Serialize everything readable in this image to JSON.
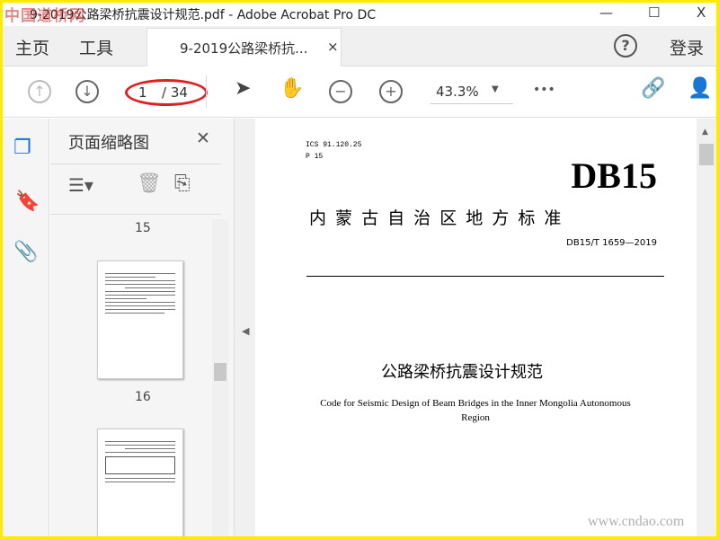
{
  "window": {
    "title": "9-2019公路梁桥抗震设计规范.pdf - Adobe Acrobat Pro DC",
    "watermark_top": "中国道桥网",
    "watermark_bottom": "www.cndao.com",
    "minimize": "—",
    "maximize": "☐",
    "close": "X"
  },
  "tabs": {
    "home": "主页",
    "tools": "工具",
    "document": "9-2019公路梁桥抗...",
    "close": "×",
    "help": "?",
    "login": "登录"
  },
  "toolbar": {
    "page_current": "1",
    "page_total": "/ 34",
    "zoom": "43.3%",
    "more": "•••"
  },
  "panel": {
    "title": "页面缩略图",
    "close": "✕",
    "thumbnails": [
      {
        "label": "15"
      },
      {
        "label": "16"
      }
    ]
  },
  "document": {
    "ics": "ICS 91.120.25",
    "p": "P 15",
    "code": "DB15",
    "org": "内 蒙 古 自 治 区 地 方 标 准",
    "std_no": "DB15/T 1659—2019",
    "title_cn": "公路梁桥抗震设计规范",
    "title_en": "Code for Seismic Design of Beam Bridges in the Inner Mongolia Autonomous Region"
  },
  "colors": {
    "accent": "#1473e6",
    "highlight": "#e02020",
    "frame": "#ffeb00"
  }
}
